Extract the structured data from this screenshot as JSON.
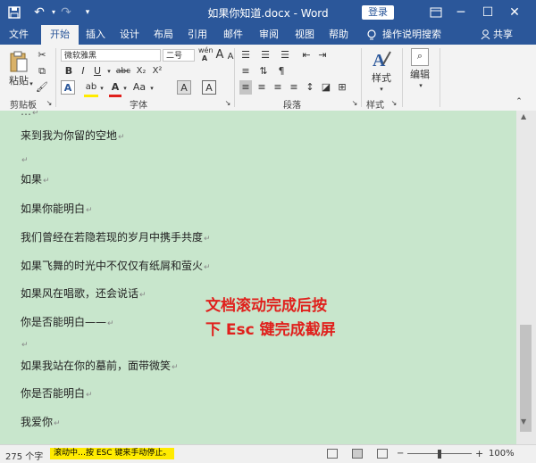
{
  "window": {
    "title": "如果你知道.docx - Word",
    "login_label": "登录",
    "icons": [
      "save-icon",
      "undo-icon",
      "redo-icon",
      "customize-quick-access-icon",
      "ribbon-display-options-icon",
      "minimize-icon",
      "maximize-icon",
      "close-icon"
    ]
  },
  "tabs": [
    {
      "label": "文件",
      "active": false
    },
    {
      "label": "开始",
      "active": true
    },
    {
      "label": "插入",
      "active": false
    },
    {
      "label": "设计",
      "active": false
    },
    {
      "label": "布局",
      "active": false
    },
    {
      "label": "引用",
      "active": false
    },
    {
      "label": "邮件",
      "active": false
    },
    {
      "label": "审阅",
      "active": false
    },
    {
      "label": "视图",
      "active": false
    },
    {
      "label": "帮助",
      "active": false
    }
  ],
  "tell_me": "操作说明搜索",
  "share": "共享",
  "ribbon": {
    "clipboard": {
      "paste": "粘贴",
      "group": "剪贴板"
    },
    "font": {
      "name": "微软雅黑",
      "size": "二号",
      "group": "字体",
      "size_up": "A",
      "size_down": "A",
      "bold": "B",
      "italic": "I",
      "underline": "U",
      "strike": "abc",
      "subscript": "X₂",
      "superscript": "X²",
      "text_effects": "A",
      "highlight": "ab",
      "font_color": "A",
      "change_case": "Aa",
      "clear_format": "A",
      "char_border": "A",
      "wen": "wén",
      "wen2": "A"
    },
    "paragraph": {
      "group": "段落"
    },
    "styles": {
      "label": "样式",
      "group": "样式"
    },
    "editing": {
      "label": "编辑"
    }
  },
  "document": {
    "lines": [
      "来到我为你留的空地",
      "",
      "如果",
      "如果你能明白",
      "我们曾经在若隐若现的岁月中携手共度",
      "如果飞舞的时光中不仅仅有纸屑和萤火",
      "如果风在唱歌，还会说话",
      "你是否能明白——",
      "",
      "如果我站在你的墓前，面带微笑",
      "你是否能明白",
      "我爱你"
    ],
    "overlay_lines": [
      "文档滚动完成后按",
      "下 Esc 键完成截屏"
    ]
  },
  "status": {
    "word_count": "275 个字",
    "scroll_note": "滚动中…按 ESC 键来手动停止。",
    "zoom": "100%"
  },
  "colors": {
    "accent": "#2b579a",
    "doc_bg": "#c8e6cc",
    "overlay_text": "#e0201c",
    "note_bg": "#ffeb00"
  }
}
